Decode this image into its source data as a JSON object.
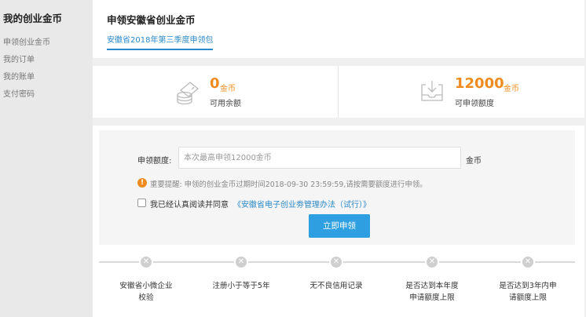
{
  "sidebar": {
    "title": "我的创业金币",
    "items": [
      {
        "label": "申领创业金币"
      },
      {
        "label": "我的订单"
      },
      {
        "label": "我的账单"
      },
      {
        "label": "支付密码"
      }
    ]
  },
  "header": {
    "title": "申领安徽省创业金币",
    "active_tab": "安徽省2018年第三季度申领包"
  },
  "stats": {
    "balance": {
      "value": "0",
      "unit": "金币",
      "label": "可用余额"
    },
    "quota": {
      "value": "12000",
      "unit": "金币",
      "label": "可申领额度"
    }
  },
  "form": {
    "amount_label": "申领额度:",
    "amount_placeholder": "本次最高申领12000金币",
    "amount_unit": "金币",
    "notice_icon": "!",
    "notice": "重要提醒: 申领的创业金币过期时间2018-09-30 23:59:59,请按需要额度进行申领。",
    "agree_text": "我已经认真阅读并同意",
    "agree_link": "《安徽省电子创业劵管理办法（试行）》",
    "submit_label": "立即申领"
  },
  "steps": [
    {
      "label": "安徽省小微企业\n校验",
      "status_icon": "x-icon"
    },
    {
      "label": "注册小于等于5年",
      "status_icon": "x-icon"
    },
    {
      "label": "无不良信用记录",
      "status_icon": "x-icon"
    },
    {
      "label": "是否达到本年度\n申请额度上限",
      "status_icon": "x-icon"
    },
    {
      "label": "是否达到3年内申\n请额度上限",
      "status_icon": "x-icon"
    }
  ],
  "colors": {
    "accent": "#2e9fe0",
    "link": "#2b89c8",
    "highlight": "#f08c1f"
  }
}
